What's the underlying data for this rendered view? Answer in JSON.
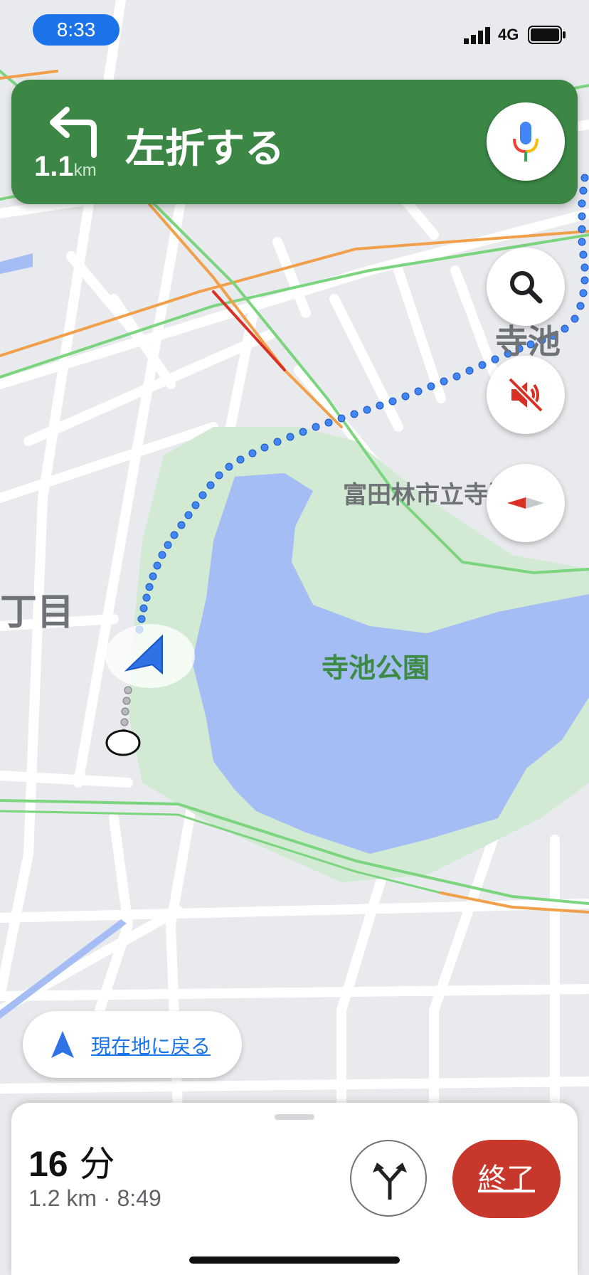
{
  "status_bar": {
    "time": "8:33",
    "network": "4G",
    "icons": [
      "signal-icon",
      "battery-icon"
    ]
  },
  "navigation": {
    "instruction": "左折する",
    "distance_value": "1.1",
    "distance_unit": "km",
    "turn_icon": "turn-left-arrow-icon",
    "mic_icon": "microphone-icon",
    "card_color": "#3c8745"
  },
  "map": {
    "labels": {
      "park": "寺池公園",
      "school": "富田林市立寺池小",
      "district_right": "寺池台",
      "district_left": "丁目"
    },
    "accent_route_color": "#4285f4",
    "water_color": "#a4bdf5",
    "park_color": "#d2e9d3"
  },
  "controls": {
    "search_icon": "search-icon",
    "mute_icon": "sound-muted-icon",
    "compass_icon": "compass-icon",
    "recenter_label": "現在地に戻る"
  },
  "trip": {
    "remaining_time": "16",
    "remaining_time_unit": "分",
    "summary": "1.2 km · 8:49",
    "alternates_icon": "alternate-routes-icon",
    "exit_label": "終了",
    "exit_color": "#c8372b"
  }
}
